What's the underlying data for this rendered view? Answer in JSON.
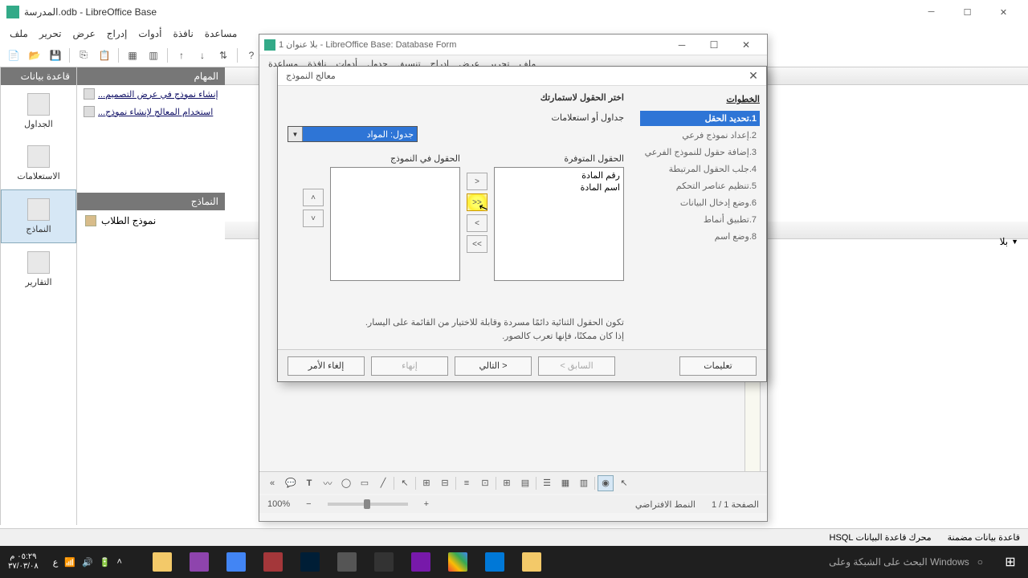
{
  "main_window": {
    "title": "المدرسة.odb - LibreOffice Base",
    "menu": [
      "ملف",
      "تحرير",
      "عرض",
      "إدراج",
      "أدوات",
      "نافذة",
      "مساعدة"
    ]
  },
  "side_panel": {
    "header": "قاعدة بيانات",
    "items": [
      "الجداول",
      "الاستعلامات",
      "النماذج",
      "التقارير"
    ],
    "active_index": 2
  },
  "tasks_panel": {
    "header": "المهام",
    "tasks": [
      "إنشاء نموذج في عرض التصميم...",
      "استخدام المعالج لإنشاء نموذج..."
    ],
    "forms_header": "النماذج",
    "forms": [
      "نموذج الطلاب"
    ]
  },
  "content_menu_label": "بلا",
  "sub_window": {
    "title": "بلا عنوان 1 - LibreOffice Base: Database Form",
    "menu": [
      "ملف",
      "تحرير",
      "عرض",
      "إدراج",
      "تنسيق",
      "جدول",
      "أدوات",
      "نافذة",
      "مساعدة"
    ],
    "page_info": "الصفحة 1 / 1",
    "style": "النمط الافتراضي",
    "zoom": "100%"
  },
  "wizard": {
    "title": "معالج النموذج",
    "steps_header": "الخطوات",
    "steps": [
      "1.تحديد الحقل",
      "2.إعداد نموذج فرعي",
      "3.إضافة حقول للنموذج الفرعي",
      "4.جلب الحقول المرتبطة",
      "5.تنظيم عناصر التحكم",
      "6.وضع إدخال البيانات",
      "7.تطبيق أنماط",
      "8.وضع اسم"
    ],
    "active_step": 0,
    "section_title": "اختر الحقول لاستمارتك",
    "combo_label": "جداول أو استعلامات",
    "combo_value": "جدول: المواد",
    "available_label": "الحقول المتوفرة",
    "available_fields": [
      "رقم المادة",
      "اسم المادة"
    ],
    "inform_label": "الحقول في النموذج",
    "hint1": "تكون الحقول الثنائية دائمًا مسردة وقابلة للاختيار من القائمة على اليسار.",
    "hint2": "إذا كان ممكنًا، فإنها تعرب كالصور.",
    "buttons": {
      "cancel": "إلغاء الأمر",
      "finish": "إنهاء",
      "next": "التالي >",
      "back": "< السابق",
      "help": "تعليمات"
    }
  },
  "statusbar": {
    "engine": "محرك قاعدة البيانات HSQL",
    "embedded": "قاعدة بيانات مضمنة"
  },
  "taskbar": {
    "time": "٠٥:٢٩ م",
    "date": "٣٧/٠٣/٠٨",
    "lang": "ع",
    "search": "البحث على الشبكة وعلى Windows"
  }
}
